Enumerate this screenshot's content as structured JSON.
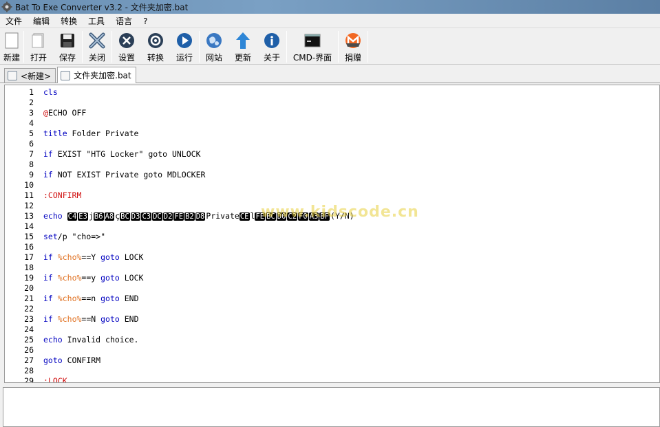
{
  "window": {
    "title": "Bat To Exe Converter v3.2 - 文件夹加密.bat"
  },
  "menu": [
    "文件",
    "编辑",
    "转换",
    "工具",
    "语言",
    "?"
  ],
  "toolbar": [
    {
      "name": "new",
      "label": "新建",
      "icon": "new-doc-icon"
    },
    {
      "name": "open",
      "label": "打开",
      "icon": "open-doc-icon"
    },
    {
      "name": "save",
      "label": "保存",
      "icon": "save-icon"
    },
    {
      "name": "close",
      "label": "关闭",
      "icon": "close-x-icon"
    },
    {
      "name": "settings",
      "label": "设置",
      "icon": "settings-circle-icon"
    },
    {
      "name": "convert",
      "label": "转换",
      "icon": "gear-icon"
    },
    {
      "name": "run",
      "label": "运行",
      "icon": "play-icon"
    },
    {
      "name": "website",
      "label": "网站",
      "icon": "globe-icon"
    },
    {
      "name": "update",
      "label": "更新",
      "icon": "up-arrow-icon"
    },
    {
      "name": "about",
      "label": "关于",
      "icon": "info-icon"
    },
    {
      "name": "cmd",
      "label": "CMD-界面",
      "icon": "console-icon"
    },
    {
      "name": "donate",
      "label": "捐赠",
      "icon": "monero-icon"
    }
  ],
  "tabs": [
    {
      "label": "<新建>",
      "active": false
    },
    {
      "label": "文件夹加密.bat",
      "active": true
    }
  ],
  "watermark": "www.kidscode.cn",
  "code_lines": [
    {
      "n": "1",
      "parts": [
        [
          "kw",
          "cls"
        ]
      ]
    },
    {
      "n": "2",
      "parts": []
    },
    {
      "n": "3",
      "parts": [
        [
          "lbl-red",
          "@"
        ],
        [
          "plain",
          "ECHO OFF"
        ]
      ]
    },
    {
      "n": "4",
      "parts": []
    },
    {
      "n": "5",
      "parts": [
        [
          "kw",
          "title"
        ],
        [
          "plain",
          " Folder Private"
        ]
      ]
    },
    {
      "n": "6",
      "parts": []
    },
    {
      "n": "7",
      "parts": [
        [
          "kw",
          "if"
        ],
        [
          "plain",
          " EXIST \"HTG Locker\" goto UNLOCK"
        ]
      ]
    },
    {
      "n": "8",
      "parts": []
    },
    {
      "n": "9",
      "parts": [
        [
          "kw",
          "if"
        ],
        [
          "plain",
          " NOT EXIST Private goto MDLOCKER"
        ]
      ]
    },
    {
      "n": "10",
      "parts": []
    },
    {
      "n": "11",
      "parts": [
        [
          "lbl-red",
          ":CONFIRM"
        ]
      ]
    },
    {
      "n": "12",
      "parts": []
    },
    {
      "n": "13",
      "parts": [
        [
          "kw",
          "echo"
        ],
        [
          "plain",
          " "
        ],
        [
          "hex",
          "C4"
        ],
        [
          "hex",
          "E3"
        ],
        [
          "plain",
          "j"
        ],
        [
          "hex",
          "B6"
        ],
        [
          "hex",
          "A8"
        ],
        [
          "plain",
          "ç"
        ],
        [
          "hex",
          "BC"
        ],
        [
          "hex",
          "D3"
        ],
        [
          "hex",
          "C3"
        ],
        [
          "hex",
          "DC"
        ],
        [
          "hex",
          "D2"
        ],
        [
          "hex",
          "FE"
        ],
        [
          "hex",
          "B2"
        ],
        [
          "hex",
          "D8"
        ],
        [
          "plain",
          "Private"
        ],
        [
          "hex",
          "CE"
        ],
        [
          "plain",
          "l"
        ],
        [
          "hex",
          "FE"
        ],
        [
          "hex",
          "BC"
        ],
        [
          "hex",
          "D0"
        ],
        [
          "hex",
          "C2"
        ],
        [
          "hex",
          "F0"
        ],
        [
          "hex",
          "A3"
        ],
        [
          "hex",
          "BF"
        ],
        [
          "plain",
          "(Y/N)"
        ]
      ]
    },
    {
      "n": "14",
      "parts": []
    },
    {
      "n": "15",
      "parts": [
        [
          "kw",
          "set"
        ],
        [
          "plain",
          "/p \"cho=>\""
        ]
      ]
    },
    {
      "n": "16",
      "parts": []
    },
    {
      "n": "17",
      "parts": [
        [
          "kw",
          "if"
        ],
        [
          "plain",
          " "
        ],
        [
          "var",
          "%cho%"
        ],
        [
          "plain",
          "==Y "
        ],
        [
          "kw",
          "goto"
        ],
        [
          "plain",
          " LOCK"
        ]
      ]
    },
    {
      "n": "18",
      "parts": []
    },
    {
      "n": "19",
      "parts": [
        [
          "kw",
          "if"
        ],
        [
          "plain",
          " "
        ],
        [
          "var",
          "%cho%"
        ],
        [
          "plain",
          "==y "
        ],
        [
          "kw",
          "goto"
        ],
        [
          "plain",
          " LOCK"
        ]
      ]
    },
    {
      "n": "20",
      "parts": []
    },
    {
      "n": "21",
      "parts": [
        [
          "kw",
          "if"
        ],
        [
          "plain",
          " "
        ],
        [
          "var",
          "%cho%"
        ],
        [
          "plain",
          "==n "
        ],
        [
          "kw",
          "goto"
        ],
        [
          "plain",
          " END"
        ]
      ]
    },
    {
      "n": "22",
      "parts": []
    },
    {
      "n": "23",
      "parts": [
        [
          "kw",
          "if"
        ],
        [
          "plain",
          " "
        ],
        [
          "var",
          "%cho%"
        ],
        [
          "plain",
          "==N "
        ],
        [
          "kw",
          "goto"
        ],
        [
          "plain",
          " END"
        ]
      ]
    },
    {
      "n": "24",
      "parts": []
    },
    {
      "n": "25",
      "parts": [
        [
          "kw",
          "echo"
        ],
        [
          "plain",
          " Invalid choice."
        ]
      ]
    },
    {
      "n": "26",
      "parts": []
    },
    {
      "n": "27",
      "parts": [
        [
          "kw",
          "goto"
        ],
        [
          "plain",
          " CONFIRM"
        ]
      ]
    },
    {
      "n": "28",
      "parts": []
    },
    {
      "n": "29",
      "parts": [
        [
          "lbl-red",
          ":LOCK"
        ]
      ]
    }
  ],
  "output_text": ""
}
